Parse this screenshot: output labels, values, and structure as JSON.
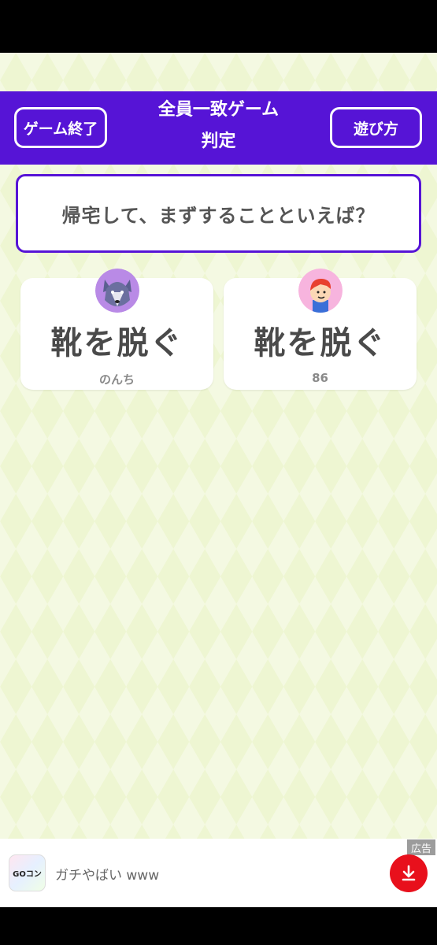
{
  "header": {
    "end_button": "ゲーム終了",
    "title_line1": "全員一致ゲーム",
    "title_line2": "判定",
    "howto_button": "遊び方"
  },
  "question": "帰宅して、まずすることといえば？",
  "answers": [
    {
      "text": "靴を脱ぐ",
      "player": "のんち",
      "avatar_icon": "wolf-avatar-icon"
    },
    {
      "text": "靴を脱ぐ",
      "player": "86",
      "avatar_icon": "boy-avatar-icon"
    }
  ],
  "ad": {
    "label": "広告",
    "logo_text": "GOコン",
    "text": "ガチやばい www",
    "download_icon": "download-icon"
  },
  "colors": {
    "brand": "#5614d6",
    "background": "#eef6d2",
    "ad_button": "#e8101c"
  }
}
